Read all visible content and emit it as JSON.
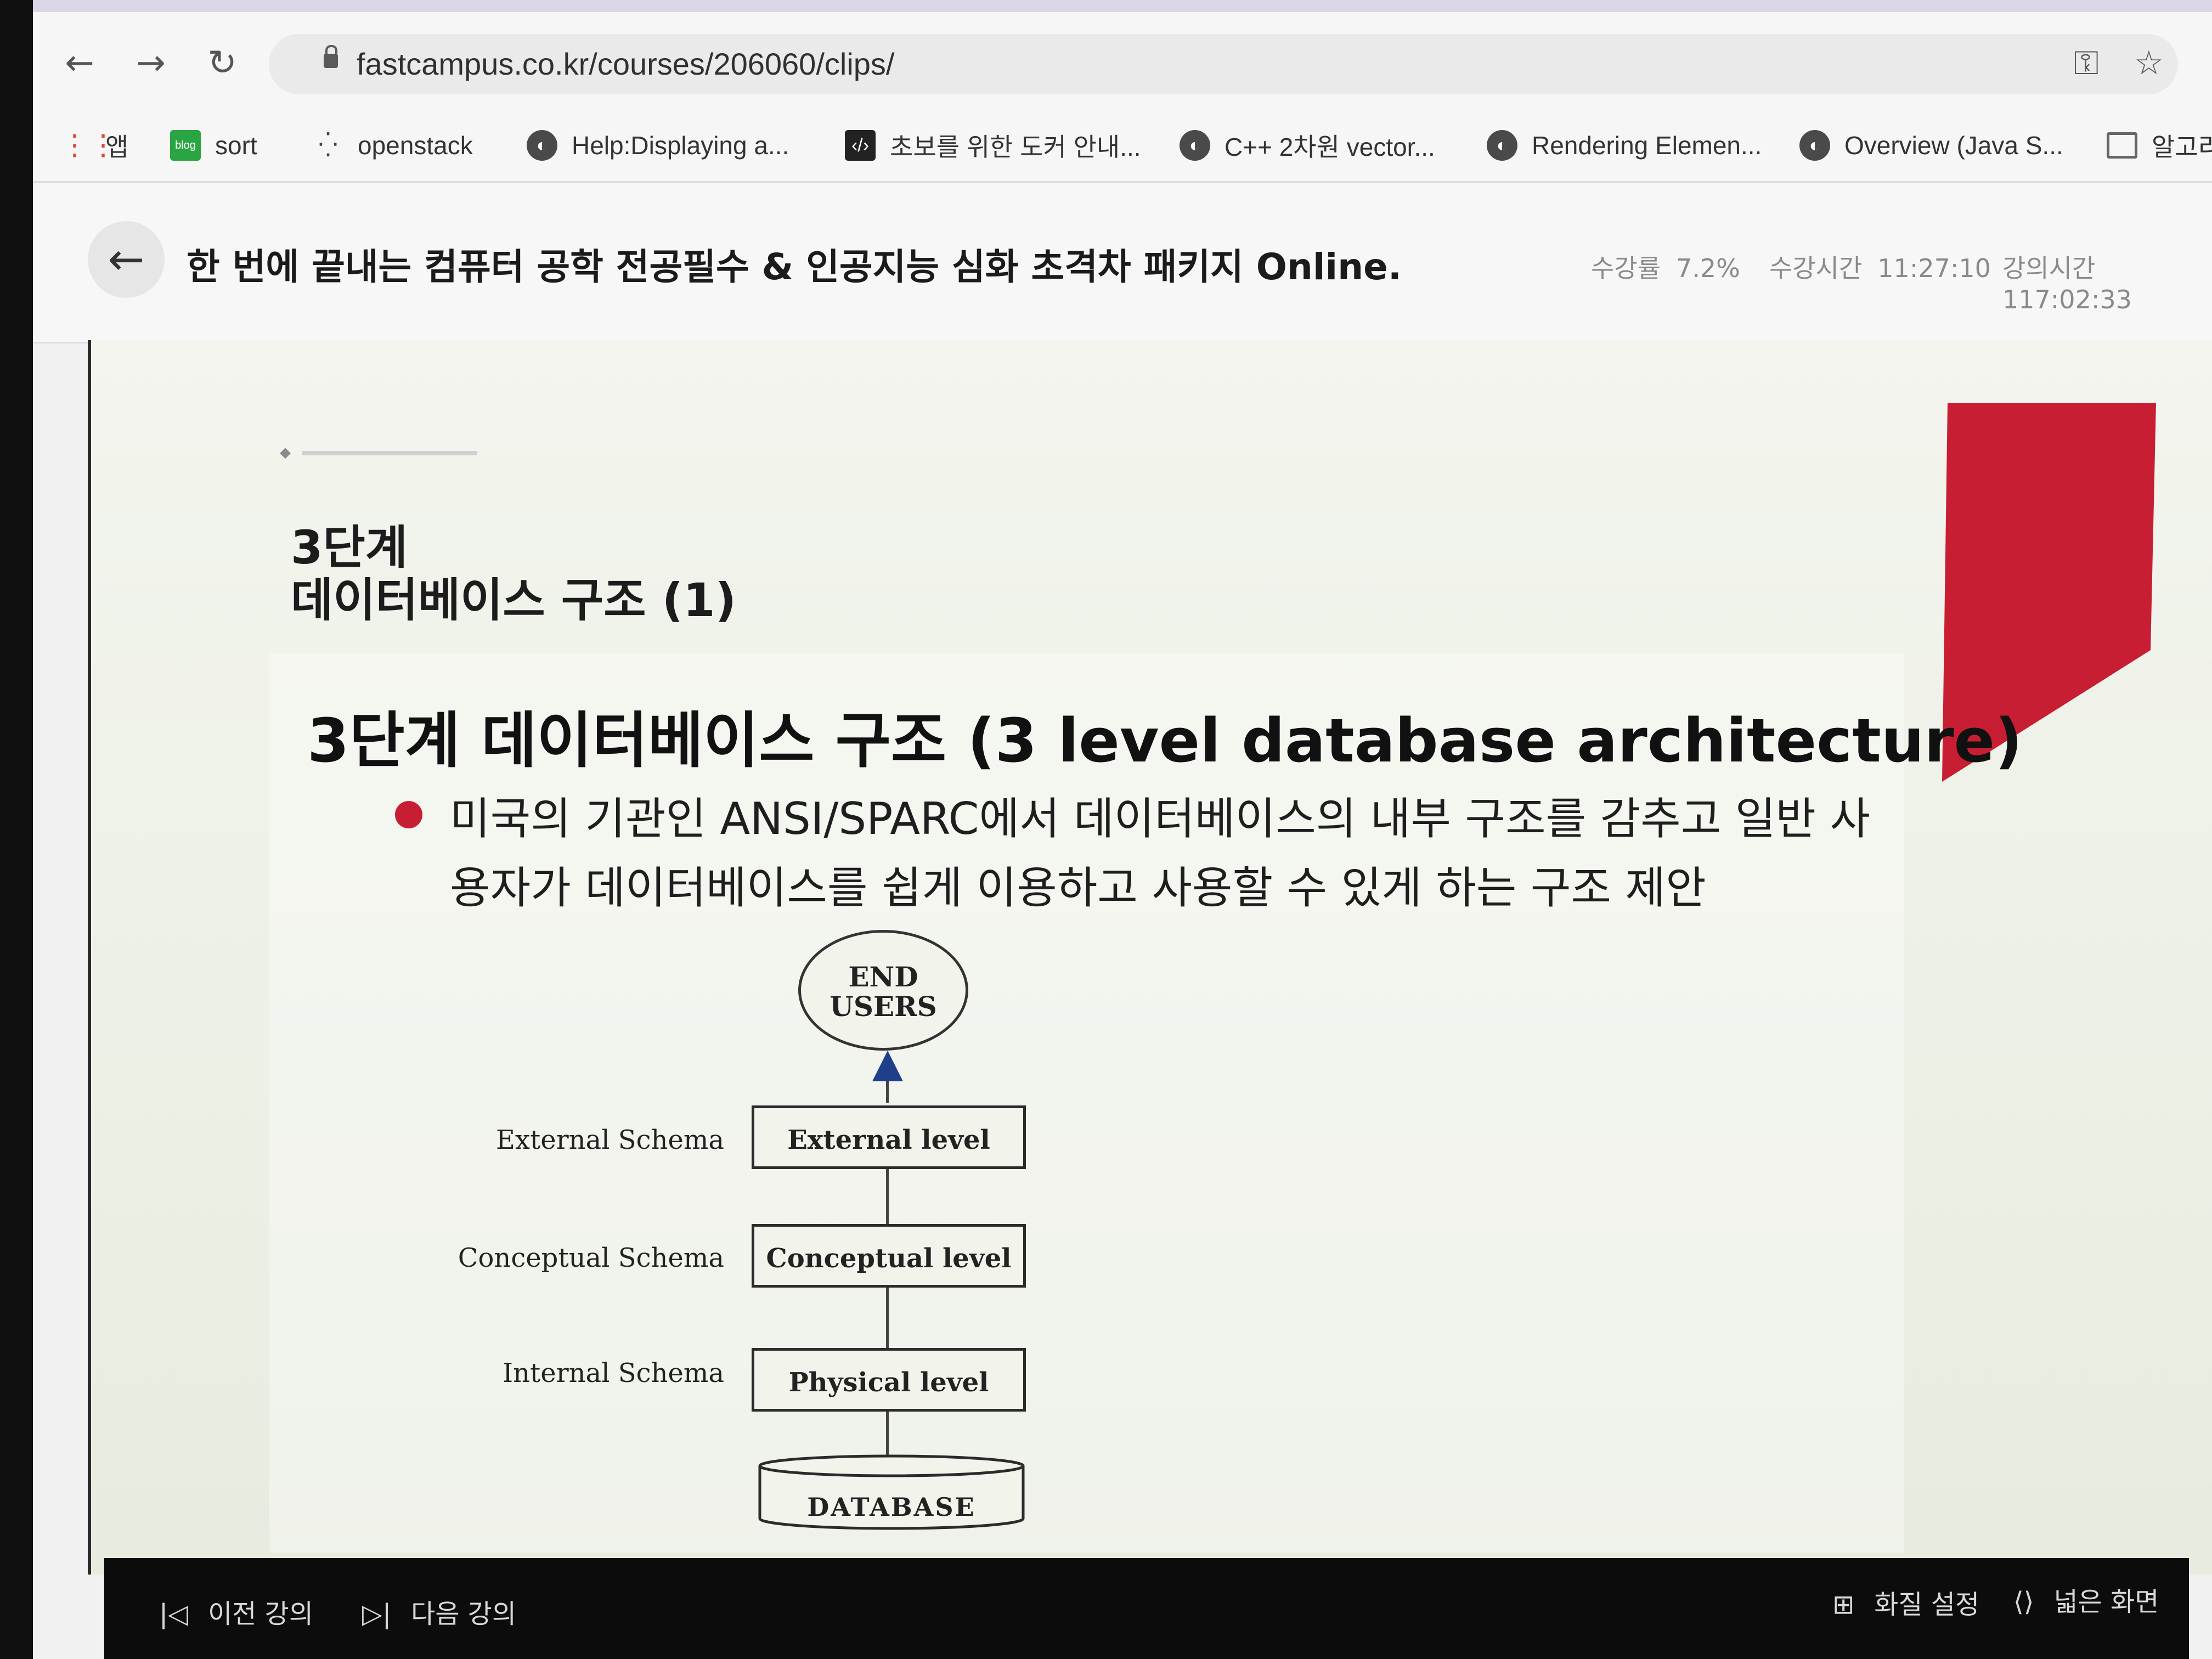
{
  "browser": {
    "url": "fastcampus.co.kr/courses/206060/clips/",
    "bookmarks": [
      {
        "label": "앱",
        "icon": "apps-grid-icon"
      },
      {
        "label": "sort",
        "icon": "blog-icon"
      },
      {
        "label": "openstack",
        "icon": "openstack-icon"
      },
      {
        "label": "Help:Displaying a...",
        "icon": "globe-icon"
      },
      {
        "label": "초보를 위한 도커 안내...",
        "icon": "code-icon"
      },
      {
        "label": "C++ 2차원 vector...",
        "icon": "globe-icon"
      },
      {
        "label": "Rendering Elemen...",
        "icon": "globe-icon"
      },
      {
        "label": "Overview (Java S...",
        "icon": "globe-icon"
      },
      {
        "label": "알고리",
        "icon": "folder-icon"
      }
    ]
  },
  "header": {
    "course_title": "한 번에 끝내는 컴퓨터 공학 전공필수 & 인공지능 심화 초격차 패키지 Online.",
    "progress_label": "수강률",
    "progress_value": "7.2%",
    "watch_time_label": "수강시간",
    "watch_time_value": "11:27:10",
    "lecture_time_label": "강의시간",
    "lecture_time_value": "117:02:33"
  },
  "slide": {
    "tag_line1": "3단계",
    "tag_line2": "데이터베이스 구조 (1)",
    "heading": "3단계 데이터베이스 구조 (3 level database architecture)",
    "bullet": "미국의 기관인 ANSI/SPARC에서 데이터베이스의 내부 구조를 감추고 일반 사용자가 데이터베이스를 쉽게 이용하고 사용할 수 있게 하는 구조 제안",
    "diagram": {
      "end_users_line1": "END",
      "end_users_line2": "USERS",
      "external_schema": "External Schema",
      "conceptual_schema": "Conceptual Schema",
      "internal_schema": "Internal Schema",
      "external_level": "External level",
      "conceptual_level": "Conceptual level",
      "physical_level": "Physical level",
      "database": "DATABASE"
    },
    "accent_color": "#c81e33"
  },
  "player": {
    "prev_label": "이전 강의",
    "next_label": "다음 강의",
    "quality_label": "화질 설정",
    "wide_label": "넓은 화면"
  }
}
